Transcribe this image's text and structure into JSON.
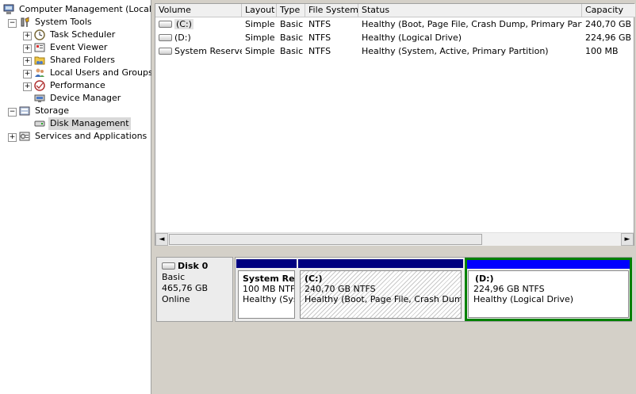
{
  "tree": {
    "root": "Computer Management (Local)",
    "system_tools": "System Tools",
    "task_scheduler": "Task Scheduler",
    "event_viewer": "Event Viewer",
    "shared_folders": "Shared Folders",
    "local_users_groups": "Local Users and Groups",
    "performance": "Performance",
    "device_manager": "Device Manager",
    "storage": "Storage",
    "disk_management": "Disk Management",
    "services_apps": "Services and Applications",
    "expand_plus": "+",
    "collapse_minus": "−"
  },
  "columns": [
    "Volume",
    "Layout",
    "Type",
    "File System",
    "Status",
    "Capacity"
  ],
  "volumes": [
    {
      "volume": "(C:)",
      "layout": "Simple",
      "type": "Basic",
      "fs": "NTFS",
      "status": "Healthy (Boot, Page File, Crash Dump, Primary Partition)",
      "capacity": "240,70 GB"
    },
    {
      "volume": "(D:)",
      "layout": "Simple",
      "type": "Basic",
      "fs": "NTFS",
      "status": "Healthy (Logical Drive)",
      "capacity": "224,96 GB"
    },
    {
      "volume": "System Reserved",
      "layout": "Simple",
      "type": "Basic",
      "fs": "NTFS",
      "status": "Healthy (System, Active, Primary Partition)",
      "capacity": "100 MB"
    }
  ],
  "scroll": {
    "left": "◄",
    "right": "►"
  },
  "disk": {
    "name": "Disk 0",
    "type": "Basic",
    "size": "465,76 GB",
    "state": "Online"
  },
  "partitions": [
    {
      "name": "System Re",
      "size": "100 MB NTFS",
      "status": "Healthy (Sysl"
    },
    {
      "name": "(C:)",
      "size": "240,70 GB NTFS",
      "status": "Healthy (Boot, Page File, Crash Dump, P"
    },
    {
      "name": "(D:)",
      "size": "224,96 GB NTFS",
      "status": "Healthy (Logical Drive)"
    }
  ],
  "colors": {
    "primary_bar": "#00007f",
    "logical_bar": "#0000ff",
    "selected_border": "#008000"
  },
  "icons": {
    "computer": "computer-icon",
    "tools": "system-tools-icon",
    "clock": "clock-icon",
    "event": "event-viewer-icon",
    "shared": "shared-folders-icon",
    "users": "users-icon",
    "performance": "performance-icon",
    "device": "device-manager-icon",
    "storage": "storage-icon",
    "disk": "disk-icon",
    "services": "services-icon"
  }
}
